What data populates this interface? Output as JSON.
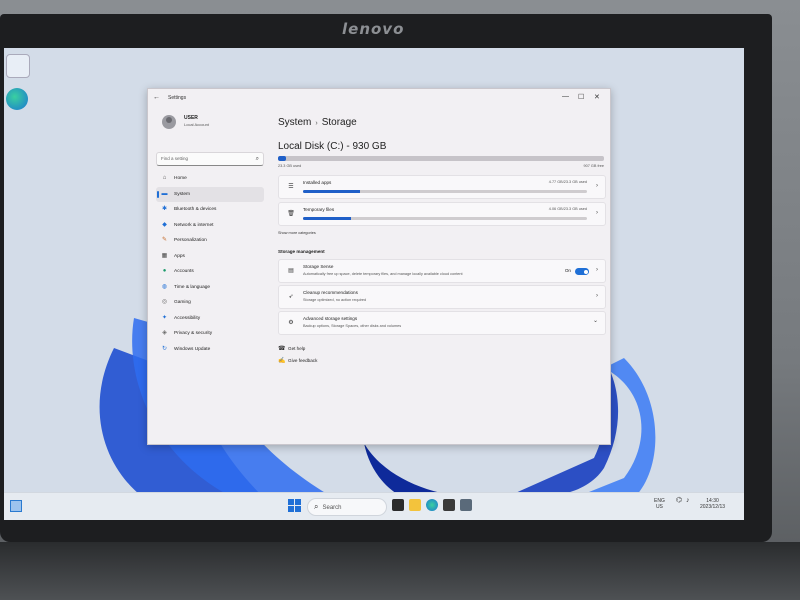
{
  "monitor": {
    "brand": "lenovo"
  },
  "window": {
    "title": "Settings"
  },
  "profile": {
    "name": "USER",
    "account": "Local Account"
  },
  "search": {
    "placeholder": "Find a setting"
  },
  "nav": [
    {
      "label": "Home",
      "icon": "home-icon"
    },
    {
      "label": "System",
      "icon": "system-icon",
      "active": true
    },
    {
      "label": "Bluetooth & devices",
      "icon": "bluetooth-icon"
    },
    {
      "label": "Network & internet",
      "icon": "wifi-icon"
    },
    {
      "label": "Personalization",
      "icon": "brush-icon"
    },
    {
      "label": "Apps",
      "icon": "apps-icon"
    },
    {
      "label": "Accounts",
      "icon": "person-icon"
    },
    {
      "label": "Time & language",
      "icon": "globe-clock-icon"
    },
    {
      "label": "Gaming",
      "icon": "gamepad-icon"
    },
    {
      "label": "Accessibility",
      "icon": "accessibility-icon"
    },
    {
      "label": "Privacy & security",
      "icon": "shield-icon"
    },
    {
      "label": "Windows Update",
      "icon": "update-icon"
    }
  ],
  "breadcrumb": {
    "parent": "System",
    "separator": "›",
    "current": "Storage"
  },
  "disk": {
    "title": "Local Disk (C:) - 930 GB",
    "used_label": "23.3 GB used",
    "free_label": "907 GB free",
    "used_fraction": 0.025
  },
  "categories": [
    {
      "title": "Installed apps",
      "size": "4.77 GB/23.3 GB used",
      "fraction": 0.2,
      "icon": "list-icon"
    },
    {
      "title": "Temporary files",
      "size": "4.06 GB/23.3 GB used",
      "fraction": 0.17,
      "icon": "trash-icon"
    }
  ],
  "show_more": "Show more categories",
  "storage_management": {
    "heading": "Storage management",
    "items": [
      {
        "title": "Storage Sense",
        "desc": "Automatically free up space, delete temporary files, and manage locally available cloud content",
        "icon": "storage-sense-icon",
        "toggle_label": "On",
        "toggle_on": true,
        "chevron": "›"
      },
      {
        "title": "Cleanup recommendations",
        "desc": "Storage optimized, no action required",
        "icon": "cleanup-icon",
        "chevron": "›"
      },
      {
        "title": "Advanced storage settings",
        "desc": "Backup options, Storage Spaces, other disks and volumes",
        "icon": "gear-icon",
        "chevron": "⌄"
      }
    ]
  },
  "help_links": [
    {
      "label": "Get help",
      "icon": "help-icon"
    },
    {
      "label": "Give feedback",
      "icon": "feedback-icon"
    }
  ],
  "taskbar": {
    "search_placeholder": "Search",
    "tray_lang": "ENG",
    "tray_region": "US",
    "clock_time": "14:30",
    "clock_date": "2023/12/13"
  },
  "colors": {
    "accent": "#1f6fd6",
    "window_bg": "#f2f0f3"
  }
}
